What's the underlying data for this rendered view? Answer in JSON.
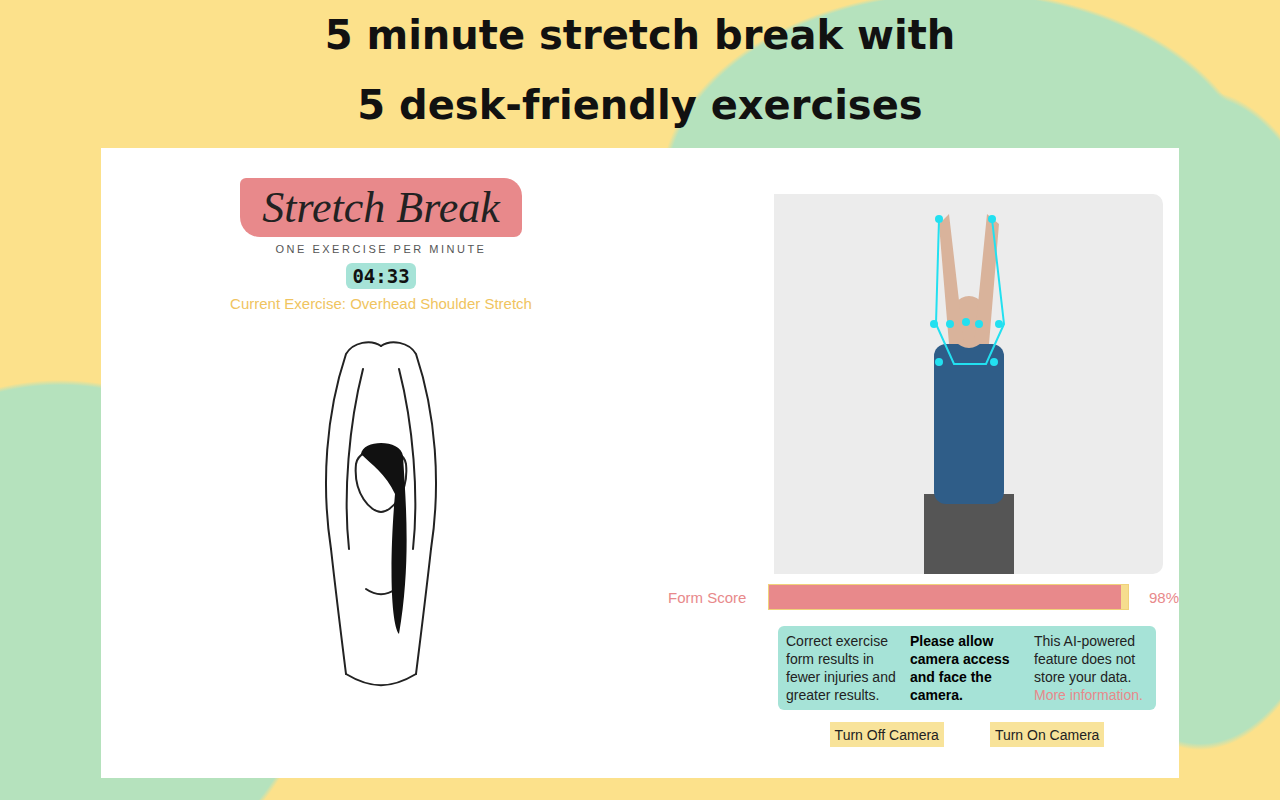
{
  "headline": [
    "5 minute stretch break with",
    "5 desk-friendly exercises"
  ],
  "app": {
    "logo": "Stretch Break",
    "tagline": "ONE EXERCISE PER MINUTE",
    "timer": "04:33",
    "current_exercise": "Current Exercise: Overhead Shoulder Stretch"
  },
  "form_score": {
    "label": "Form Score",
    "level": 0.98,
    "reading": "98%"
  },
  "info": {
    "left": "Correct exercise form results in fewer injuries and greater results.",
    "middle": "Please allow camera access and face the camera.",
    "right": "This AI-powered feature does not store your data.",
    "link": "More information."
  },
  "buttons": [
    "Turn Off Camera",
    "Turn On Camera"
  ]
}
